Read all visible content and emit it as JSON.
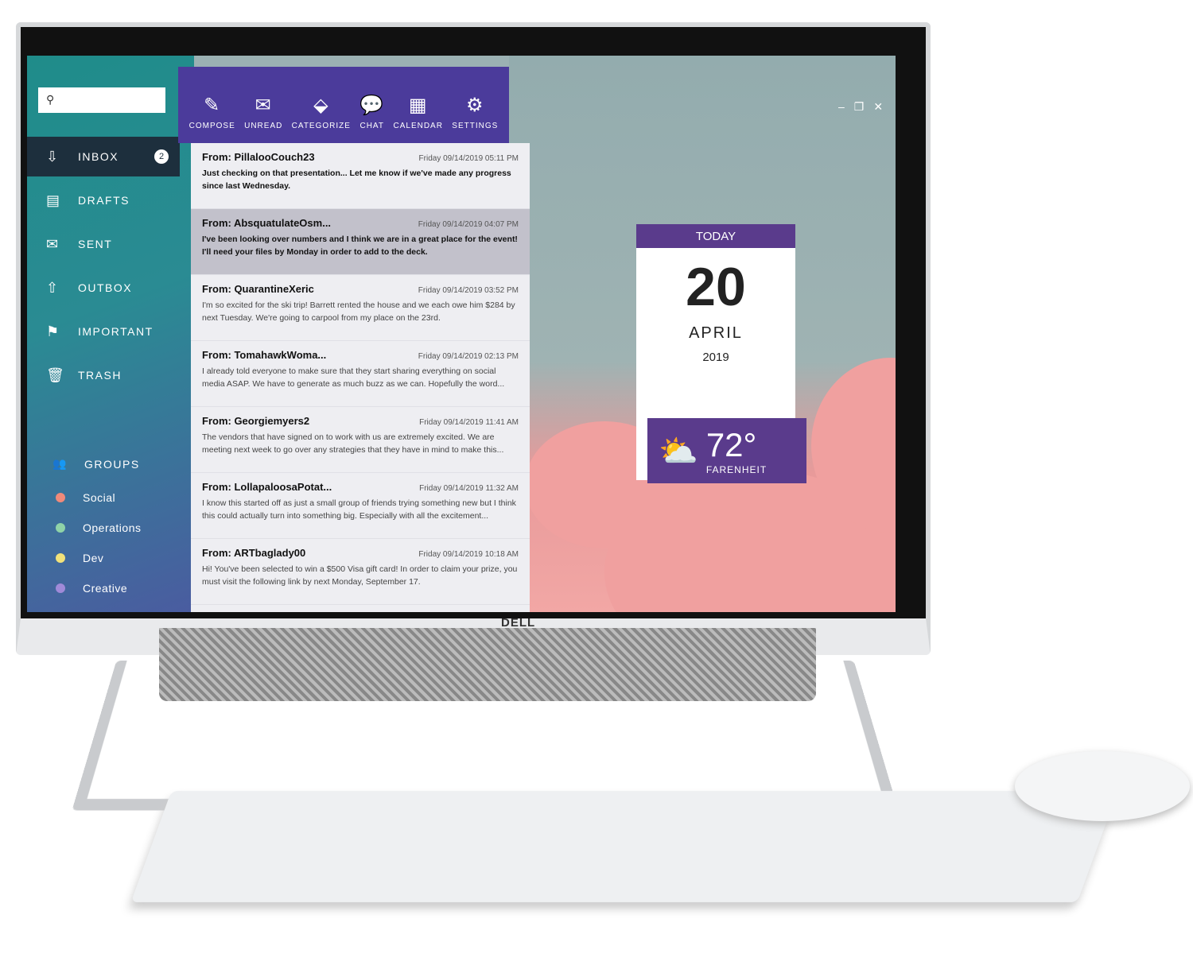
{
  "search": {
    "placeholder": ""
  },
  "nav": [
    {
      "label": "INBOX",
      "icon": "inbox-icon",
      "badge": "2"
    },
    {
      "label": "DRAFTS",
      "icon": "document-icon"
    },
    {
      "label": "SENT",
      "icon": "sent-mail-icon"
    },
    {
      "label": "OUTBOX",
      "icon": "outbox-icon"
    },
    {
      "label": "IMPORTANT",
      "icon": "flag-icon"
    },
    {
      "label": "TRASH",
      "icon": "trash-icon"
    }
  ],
  "groups": {
    "label": "GROUPS",
    "items": [
      {
        "label": "Social",
        "color": "#f08a7a"
      },
      {
        "label": "Operations",
        "color": "#8fd3a8"
      },
      {
        "label": "Dev",
        "color": "#f2e27a"
      },
      {
        "label": "Creative",
        "color": "#a08ad8"
      }
    ]
  },
  "toolbar": [
    {
      "label": "COMPOSE",
      "icon": "pencil-icon"
    },
    {
      "label": "UNREAD",
      "icon": "envelope-icon"
    },
    {
      "label": "CATEGORIZE",
      "icon": "tag-icon"
    },
    {
      "label": "CHAT",
      "icon": "chat-icon"
    },
    {
      "label": "CALENDAR",
      "icon": "calendar-icon"
    },
    {
      "label": "SETTINGS",
      "icon": "gear-icon"
    }
  ],
  "mails": [
    {
      "from": "From: PillalooCouch23",
      "date": "Friday 09/14/2019 05:11 PM",
      "body": "Just checking on that presentation... Let me know if we've made any progress since last Wednesday."
    },
    {
      "from": "From: AbsquatulateOsm...",
      "date": "Friday 09/14/2019 04:07 PM",
      "body": "I've been looking over numbers and I think we are in a great place for the event! I'll need your files by Monday in order to add to the deck."
    },
    {
      "from": "From: QuarantineXeric",
      "date": "Friday 09/14/2019 03:52 PM",
      "body": "I'm so excited for the ski trip! Barrett rented the house and we each owe him $284 by next Tuesday. We're going to carpool from my place on the 23rd."
    },
    {
      "from": "From: TomahawkWoma...",
      "date": "Friday 09/14/2019 02:13 PM",
      "body": "I already told everyone to make sure that they start sharing everything on social media ASAP. We have to generate as much buzz as we can. Hopefully the word..."
    },
    {
      "from": "From: Georgiemyers2",
      "date": "Friday 09/14/2019 11:41 AM",
      "body": "The vendors that have signed on to work with us are extremely excited. We are meeting next week to go over any strategies that they have in mind to make this..."
    },
    {
      "from": "From: LollapaloosaPotat...",
      "date": "Friday 09/14/2019 11:32 AM",
      "body": "I know this started off as just a small group of friends trying something new but I think this could actually turn into something big. Especially with all the excitement..."
    },
    {
      "from": "From: ARTbaglady00",
      "date": "Friday 09/14/2019 10:18 AM",
      "body": "Hi! You've been selected to win a $500 Visa gift card! In order to claim your prize, you must visit the following link by next Monday, September 17."
    }
  ],
  "calendar": {
    "header": "TODAY",
    "day": "20",
    "month": "APRIL",
    "year": "2019"
  },
  "weather": {
    "temp": "72°",
    "unit": "FARENHEIT",
    "icon": "partly-cloudy-icon"
  },
  "window_controls": {
    "minimize": "–",
    "restore": "❐",
    "close": "✕"
  },
  "brand": "DELL",
  "colors": {
    "toolbar": "#4b3b9b",
    "calendar": "#5a3b8c",
    "active_nav": "#1d2f3d"
  }
}
